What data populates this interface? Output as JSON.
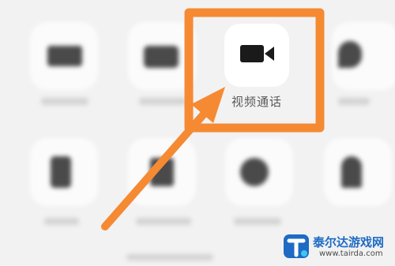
{
  "screen": {
    "focused_item": {
      "label": "视频通话",
      "icon": "video-camera-icon"
    },
    "blurred_items": [
      {
        "icon": "image-icon"
      },
      {
        "icon": "camera-icon"
      },
      {
        "icon": "location-pin-icon"
      },
      {
        "icon": "phone-icon"
      },
      {
        "icon": "contact-icon"
      },
      {
        "icon": "user-icon"
      }
    ]
  },
  "annotation": {
    "color": "#f58a33",
    "shape": "highlight-box-with-arrow"
  },
  "watermark": {
    "site_name": "泰尔达游戏网",
    "url": "www.tairda.com",
    "brand_color": "#1e6bc4"
  }
}
